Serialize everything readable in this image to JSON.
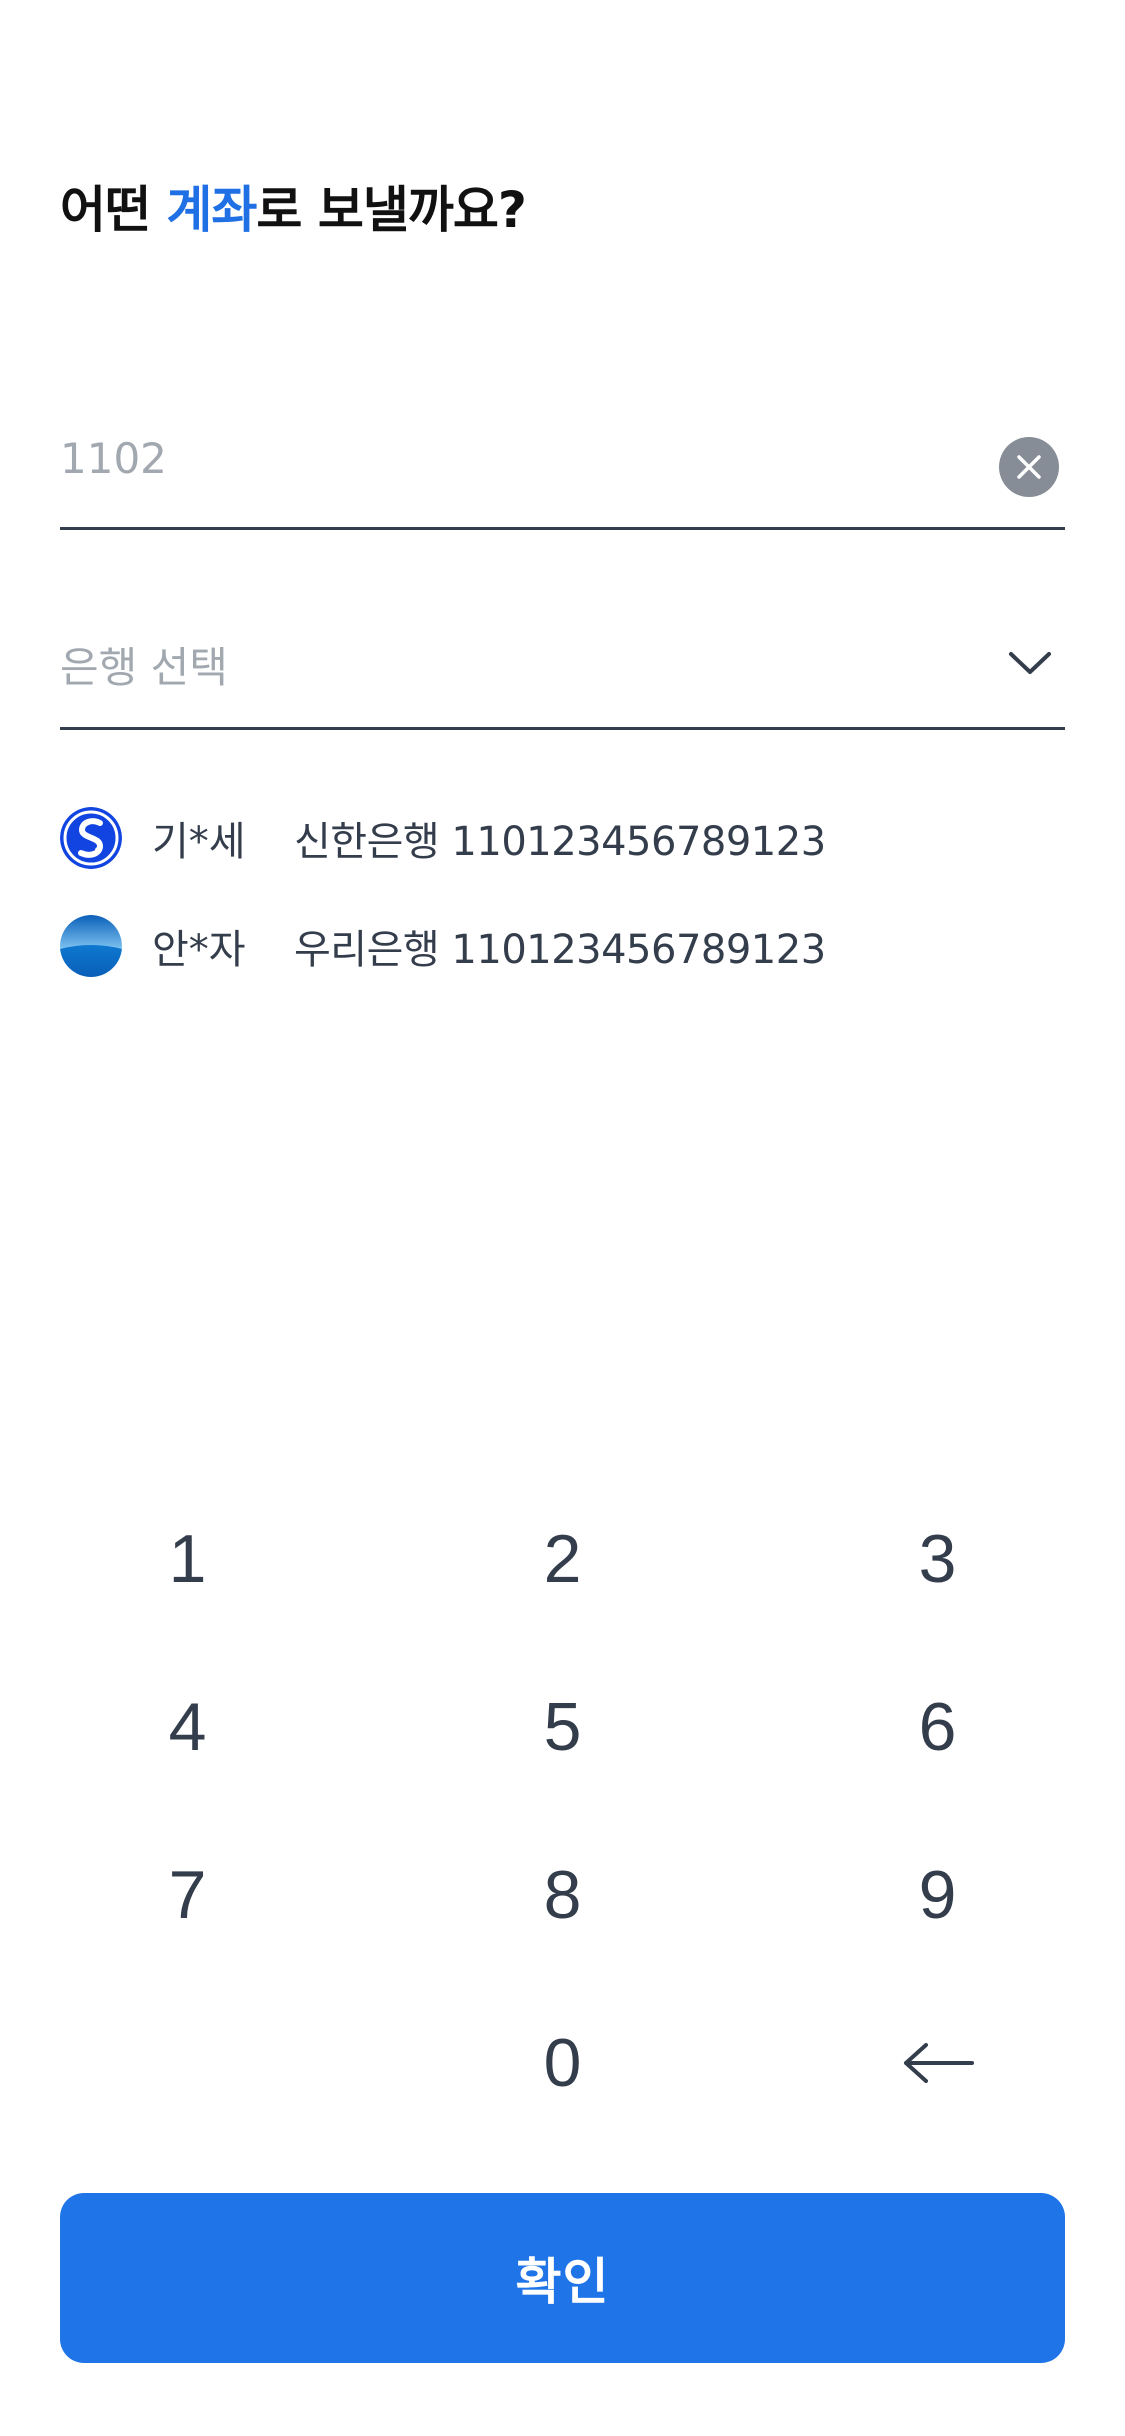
{
  "header": {
    "title_prefix": "어떤 ",
    "title_accent": "계좌",
    "title_suffix": "로 보낼까요?",
    "accent_color": "#1f6fe5"
  },
  "account_field": {
    "value": "1102",
    "clear_icon": "close-icon"
  },
  "bank_field": {
    "placeholder": "은행 선택",
    "dropdown_icon": "chevron-down-icon"
  },
  "recent_accounts": [
    {
      "logo_icon": "shinhan-bank-logo",
      "name": "기*세",
      "bank_and_account": "신한은행 110123456789123"
    },
    {
      "logo_icon": "woori-bank-logo",
      "name": "안*자",
      "bank_and_account": "우리은행 110123456789123"
    }
  ],
  "keypad": {
    "rows": [
      [
        "1",
        "2",
        "3"
      ],
      [
        "4",
        "5",
        "6"
      ],
      [
        "7",
        "8",
        "9"
      ],
      [
        "",
        "0",
        "←"
      ]
    ],
    "backspace_icon": "backspace-arrow-icon"
  },
  "confirm_button": {
    "label": "확인",
    "color": "#1f75e8"
  }
}
